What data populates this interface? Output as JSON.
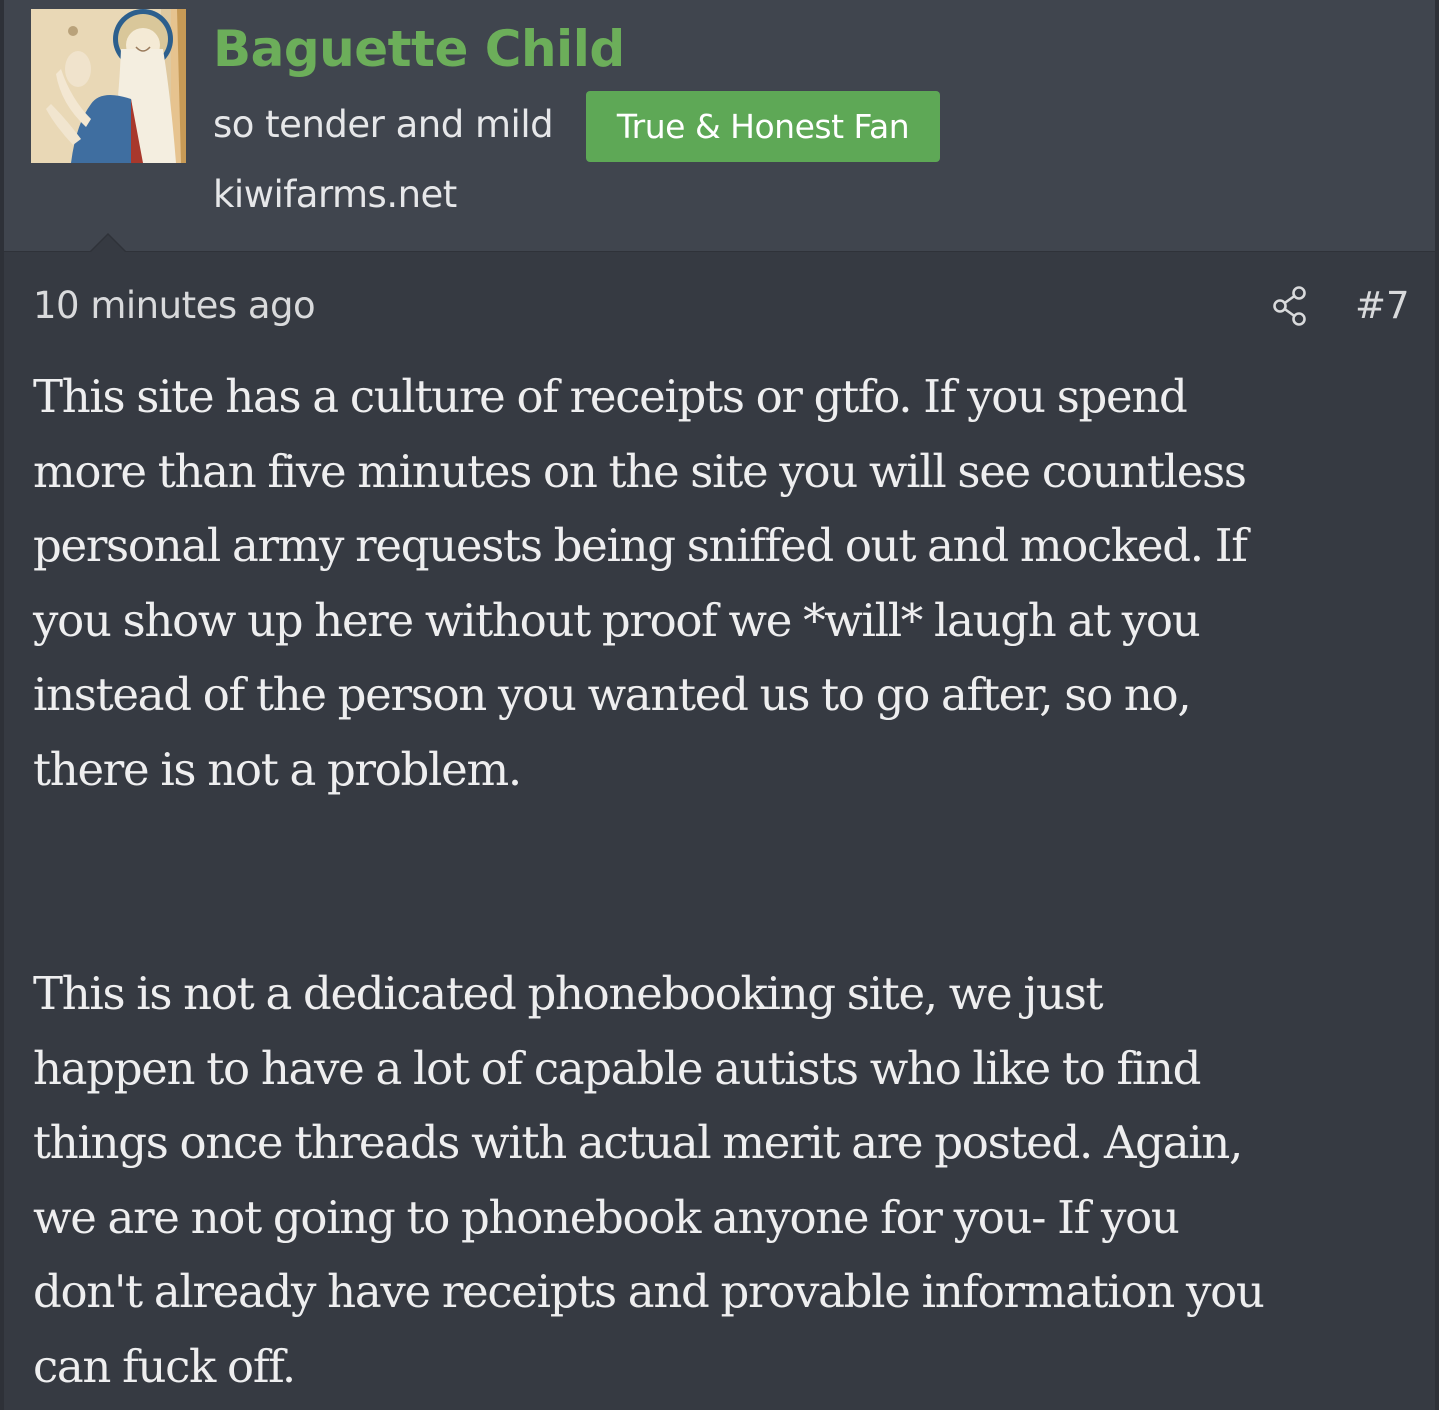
{
  "user": {
    "username": "Baguette Child",
    "title": "so tender and mild",
    "banner": "True & Honest Fan",
    "site": "kiwifarms.net"
  },
  "post": {
    "time": "10 minutes ago",
    "number": "#7",
    "paragraph1_lines": [
      "This site has a culture of receipts or gtfo. If you spend",
      "more than five minutes on the site you will see countless",
      "personal army requests being sniffed out and mocked. If",
      "you show up here without proof we *will* laugh at you",
      "instead of the person you wanted us to go after, so no,",
      "there is not a problem."
    ],
    "paragraph2_lines": [
      "This is not a dedicated phonebooking site, we just",
      "happen to have a lot of capable autists who like to find",
      "things once threads with actual merit are posted. Again,",
      "we are not going to phonebook anyone for you- If you",
      "don't already have receipts and provable information you",
      "can fuck off."
    ]
  },
  "colors": {
    "background": "#363a42",
    "header_background": "#40454e",
    "username": "#6cae5a",
    "banner": "#5ea856",
    "text": "#eeeeef"
  },
  "icons": {
    "avatar": "medieval-illumination-avatar",
    "share": "share-icon"
  }
}
